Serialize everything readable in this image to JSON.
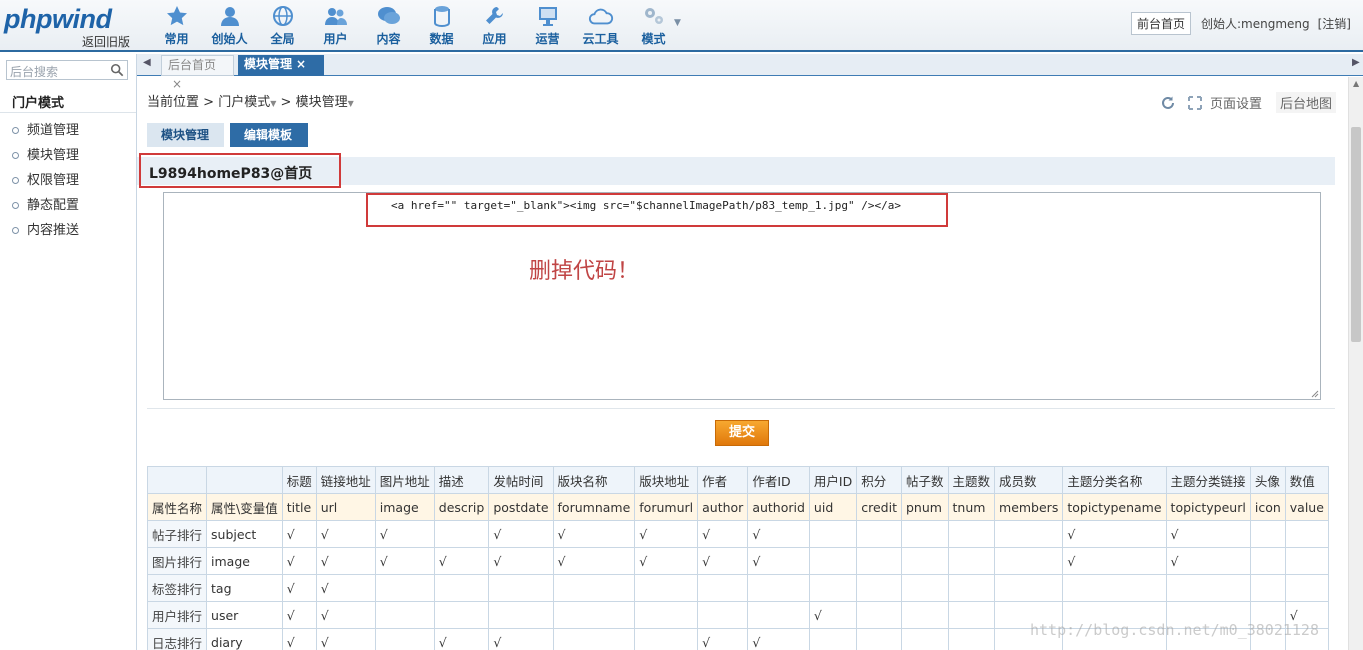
{
  "header": {
    "logo": "phpwind",
    "logo_sub": "返回旧版",
    "nav": [
      {
        "label": "常用",
        "icon": "star-icon"
      },
      {
        "label": "创始人",
        "icon": "user-icon"
      },
      {
        "label": "全局",
        "icon": "globe-icon"
      },
      {
        "label": "用户",
        "icon": "users-icon"
      },
      {
        "label": "内容",
        "icon": "chat-icon"
      },
      {
        "label": "数据",
        "icon": "database-icon"
      },
      {
        "label": "应用",
        "icon": "wrench-icon"
      },
      {
        "label": "运营",
        "icon": "monitor-icon"
      },
      {
        "label": "云工具",
        "icon": "cloud-icon"
      },
      {
        "label": "模式",
        "icon": "gears-icon"
      }
    ],
    "front_button": "前台首页",
    "creator": "创始人:mengmeng",
    "logout": "[注销]"
  },
  "sidebar": {
    "search_placeholder": "后台搜索",
    "title": "门户模式",
    "items": [
      "频道管理",
      "模块管理",
      "权限管理",
      "静态配置",
      "内容推送"
    ]
  },
  "tabs": {
    "inactive": "后台首页",
    "active": "模块管理",
    "close": "×"
  },
  "main": {
    "breadcrumb": {
      "root": "当前位置",
      "level1": "门户模式",
      "level2": "模块管理",
      "sep": ">"
    },
    "tools": {
      "settings": "页面设置",
      "map": "后台地图"
    },
    "subtabs": [
      "模块管理",
      "编辑模板"
    ],
    "section_title": "L9894homeP83@首页",
    "template_code": "<a href=\"\" target=\"_blank\"><img src=\"$channelImagePath/p83_temp_1.jpg\" /></a>",
    "annotation": "删掉代码！",
    "submit": "提交"
  },
  "attr_table": {
    "header_row": [
      "",
      "",
      "标题",
      "链接地址",
      "图片地址",
      "描述",
      "发帖时间",
      "版块名称",
      "版块地址",
      "作者",
      "作者ID",
      "用户ID",
      "积分",
      "帖子数",
      "主题数",
      "成员数",
      "主题分类名称",
      "主题分类链接",
      "头像",
      "数值"
    ],
    "vars_row": [
      "属性名称",
      "属性\\变量值",
      "title",
      "url",
      "image",
      "descrip",
      "postdate",
      "forumname",
      "forumurl",
      "author",
      "authorid",
      "uid",
      "credit",
      "pnum",
      "tnum",
      "members",
      "topictypename",
      "topictypeurl",
      "icon",
      "value"
    ],
    "rows": [
      [
        "帖子排行",
        "subject",
        "√",
        "√",
        "√",
        "",
        "√",
        "√",
        "√",
        "√",
        "√",
        "",
        "",
        "",
        "",
        "",
        "√",
        "√",
        "",
        ""
      ],
      [
        "图片排行",
        "image",
        "√",
        "√",
        "√",
        "√",
        "√",
        "√",
        "√",
        "√",
        "√",
        "",
        "",
        "",
        "",
        "",
        "√",
        "√",
        "",
        ""
      ],
      [
        "标签排行",
        "tag",
        "√",
        "√",
        "",
        "",
        "",
        "",
        "",
        "",
        "",
        "",
        "",
        "",
        "",
        "",
        "",
        "",
        "",
        ""
      ],
      [
        "用户排行",
        "user",
        "√",
        "√",
        "",
        "",
        "",
        "",
        "",
        "",
        "",
        "√",
        "",
        "",
        "",
        "",
        "",
        "",
        "",
        "√"
      ],
      [
        "日志排行",
        "diary",
        "√",
        "√",
        "",
        "√",
        "√",
        "",
        "",
        "√",
        "√",
        "",
        "",
        "",
        "",
        "",
        "",
        "",
        "",
        ""
      ]
    ]
  },
  "watermark": "http://blog.csdn.net/m0_38021128"
}
